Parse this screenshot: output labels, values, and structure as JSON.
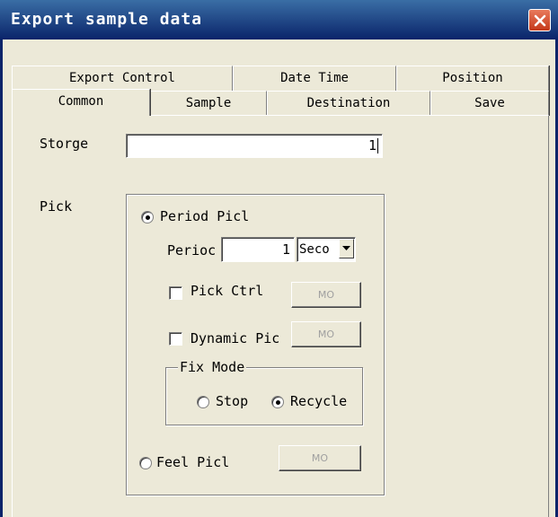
{
  "window": {
    "title": "Export sample data"
  },
  "tabs": {
    "row_back": [
      {
        "label": "Export Control"
      },
      {
        "label": "Date Time"
      },
      {
        "label": "Position"
      }
    ],
    "row_front": [
      {
        "label": "Common",
        "active": true
      },
      {
        "label": "Sample"
      },
      {
        "label": "Destination"
      },
      {
        "label": "Save"
      }
    ]
  },
  "common": {
    "storge_label": "Storge",
    "storge_value": "1",
    "pick_label": "Pick",
    "period_pick_label": "Period Picl",
    "period_label": "Perioc",
    "period_value": "1",
    "period_unit": "Seco",
    "pick_ctrl_label": "Pick Ctrl",
    "pick_ctrl_button": "MO",
    "dynamic_pick_label": "Dynamic Pic",
    "dynamic_pick_button": "MO",
    "fix_mode_label": "Fix Mode",
    "fix_mode_options": [
      "Stop",
      "Recycle"
    ],
    "feel_pick_label": "Feel Picl",
    "feel_pick_button": "MO"
  },
  "state": {
    "pick_mode": "Period Picl",
    "fix_mode": "Recycle",
    "pick_ctrl_checked": false,
    "dynamic_pick_checked": false
  },
  "colors": {
    "titlebar": "#0a246a",
    "dialog_bg": "#ece9d8",
    "close_button": "#c5381a"
  }
}
